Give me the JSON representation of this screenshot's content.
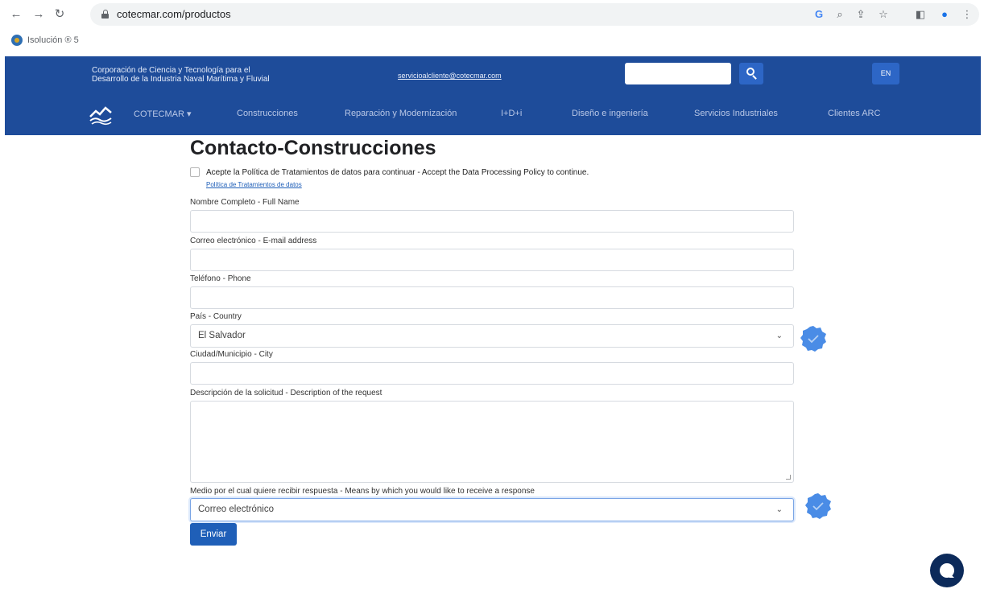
{
  "browser": {
    "url": "cotecmar.com/productos",
    "bookmark": "Isolución ® 5"
  },
  "header": {
    "org_line1": "Corporación de Ciencia y Tecnología para el",
    "org_line2": "Desarrollo de la Industria Naval Marítima y Fluvial",
    "email": "servicioalcliente@cotecmar.com",
    "search_placeholder": "",
    "lang_button": "EN",
    "menu": [
      {
        "label": "COTECMAR ▾"
      },
      {
        "label": "Construcciones"
      },
      {
        "label": "Reparación y Modernización"
      },
      {
        "label": "I+D+i"
      },
      {
        "label": "Diseño e ingeniería"
      },
      {
        "label": "Servicios Industriales"
      },
      {
        "label": "Clientes ARC"
      }
    ]
  },
  "form": {
    "title": "Contacto-Construcciones",
    "policy_accept": "Acepte la Política de Tratamientos de datos para continuar - Accept the Data Processing Policy to continue.",
    "policy_link": "Política de Tratamientos de datos",
    "full_name_label": "Nombre Completo - Full Name",
    "email_label": "Correo electrónico - E-mail address",
    "phone_label": "Teléfono - Phone",
    "country_label": "País - Country",
    "country_value": "El Salvador",
    "city_label": "Ciudad/Municipio - City",
    "description_label": "Descripción de la solicitud - Description of the request",
    "response_label": "Medio por el cual quiere recibir respuesta - Means by which you would like to receive a response",
    "response_value": "Correo electrónico",
    "submit_label": "Enviar"
  },
  "colors": {
    "header_bg": "#1e4c9a",
    "button_blue": "#1f5fb8",
    "badge_blue": "#4a8ce6"
  }
}
